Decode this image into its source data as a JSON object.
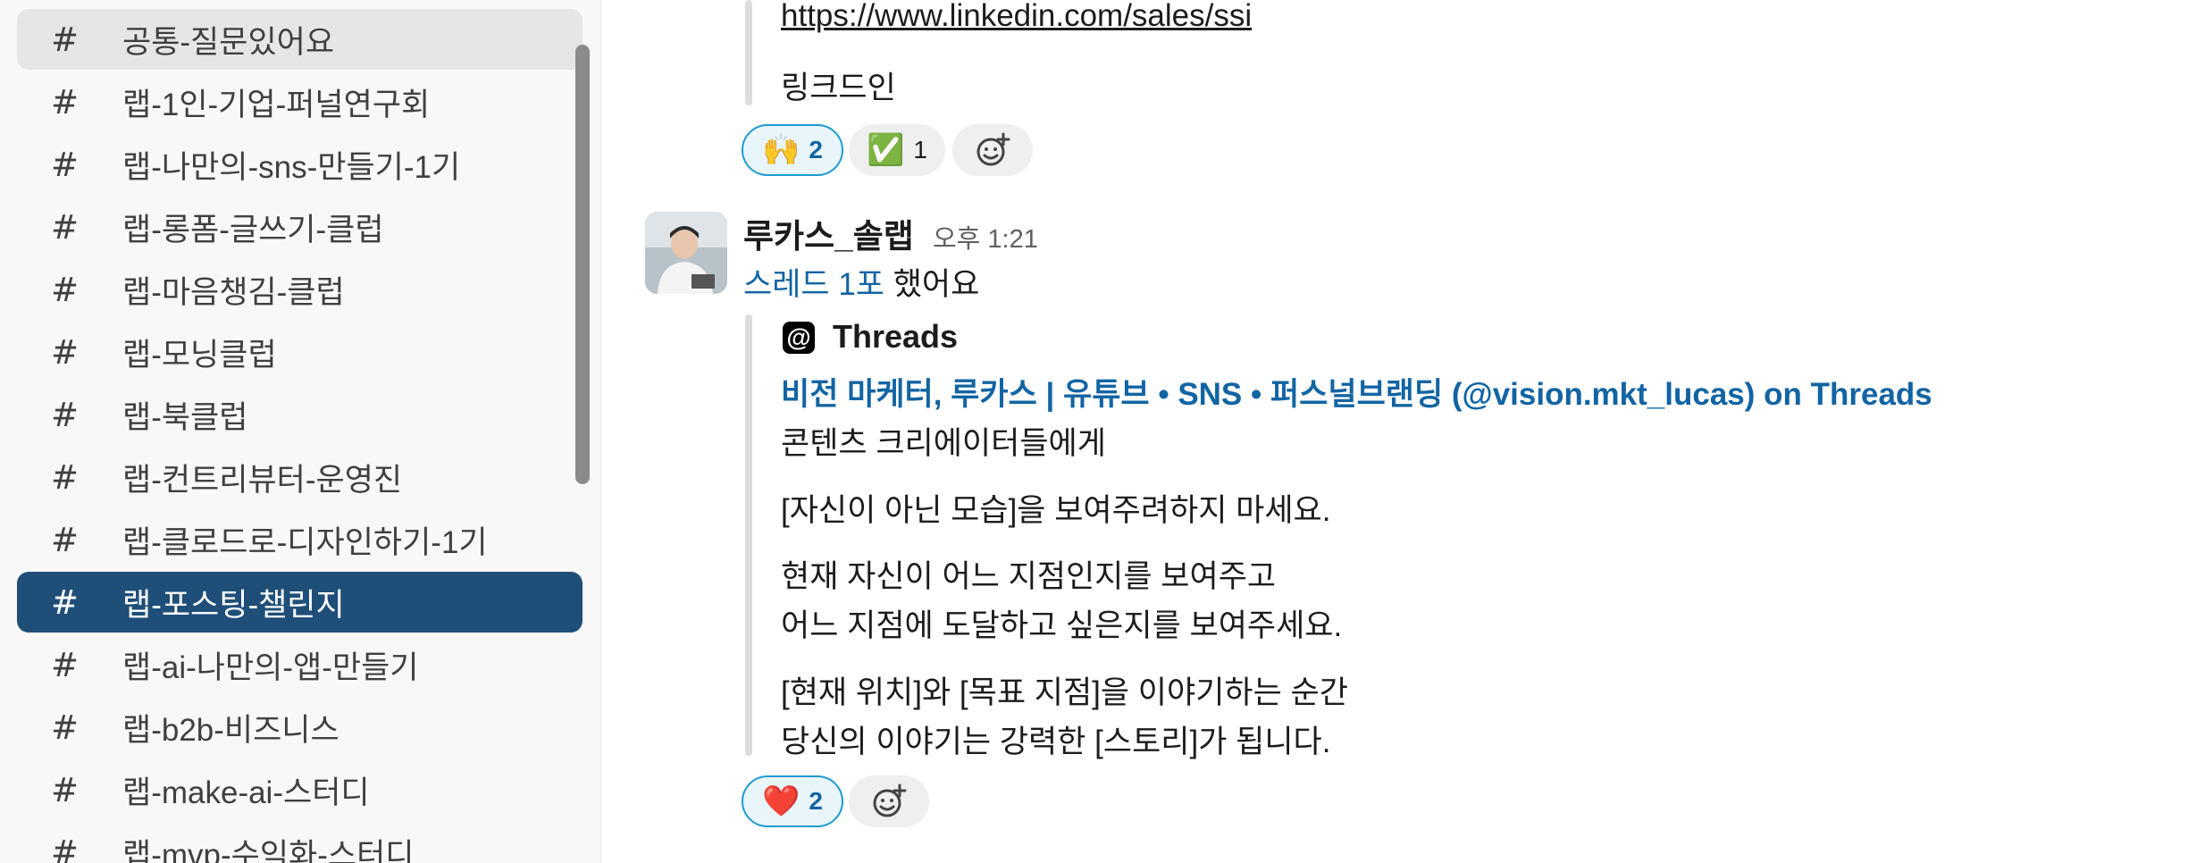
{
  "sidebar": {
    "channels": [
      {
        "prefix": "#",
        "label": "공통-질문있어요"
      },
      {
        "prefix": "#",
        "label": "랩-1인-기업-퍼널연구회"
      },
      {
        "prefix": "#",
        "label": "랩-나만의-sns-만들기-1기"
      },
      {
        "prefix": "#",
        "label": "랩-롱폼-글쓰기-클럽"
      },
      {
        "prefix": "#",
        "label": "랩-마음챙김-클럽"
      },
      {
        "prefix": "#",
        "label": "랩-모닝클럽"
      },
      {
        "prefix": "#",
        "label": "랩-북클럽"
      },
      {
        "prefix": "#",
        "label": "랩-컨트리뷰터-운영진"
      },
      {
        "prefix": "#",
        "label": "랩-클로드로-디자인하기-1기"
      },
      {
        "prefix": "#",
        "label": "랩-포스팅-챌린지"
      },
      {
        "prefix": "#",
        "label": "랩-ai-나만의-앱-만들기"
      },
      {
        "prefix": "#",
        "label": "랩-b2b-비즈니스"
      },
      {
        "prefix": "#",
        "label": "랩-make-ai-스터디"
      },
      {
        "prefix": "#",
        "label": "랩-mvp-수익화-스터디"
      }
    ],
    "active_channel": "랩-포스팅-챌린지"
  },
  "messages": {
    "first": {
      "link": "https://www.linkedin.com/sales/ssi",
      "text": "링크드인",
      "reactions": [
        {
          "emoji": "🙌",
          "count": "2",
          "mine": true
        },
        {
          "emoji": "✅",
          "count": "1",
          "mine": false
        }
      ]
    },
    "second": {
      "sender": "루카스_솔랩",
      "time": "오후 1:21",
      "thread_link": "스레드 1포",
      "thread_suffix": " 했어요",
      "unfurl": {
        "service": "Threads",
        "title": "비전 마케터, 루카스 | 유튜브 • SNS • 퍼스널브랜딩 (@vision.mkt_lucas) on Threads",
        "lines": [
          "콘텐츠 크리에이터들에게",
          "[자신이 아닌 모습]을 보여주려하지 마세요.",
          "현재 자신이 어느 지점인지를 보여주고",
          "어느 지점에 도달하고 싶은지를 보여주세요.",
          "[현재 위치]와 [목표 지점]을 이야기하는 순간",
          "당신의 이야기는 강력한 [스토리]가 됩니다."
        ]
      },
      "reactions": [
        {
          "emoji": "❤️",
          "count": "2",
          "mine": true
        }
      ]
    }
  },
  "colors": {
    "active": "#1f4f79",
    "link": "#1264a3",
    "reaction_border": "#1d9bd1"
  }
}
